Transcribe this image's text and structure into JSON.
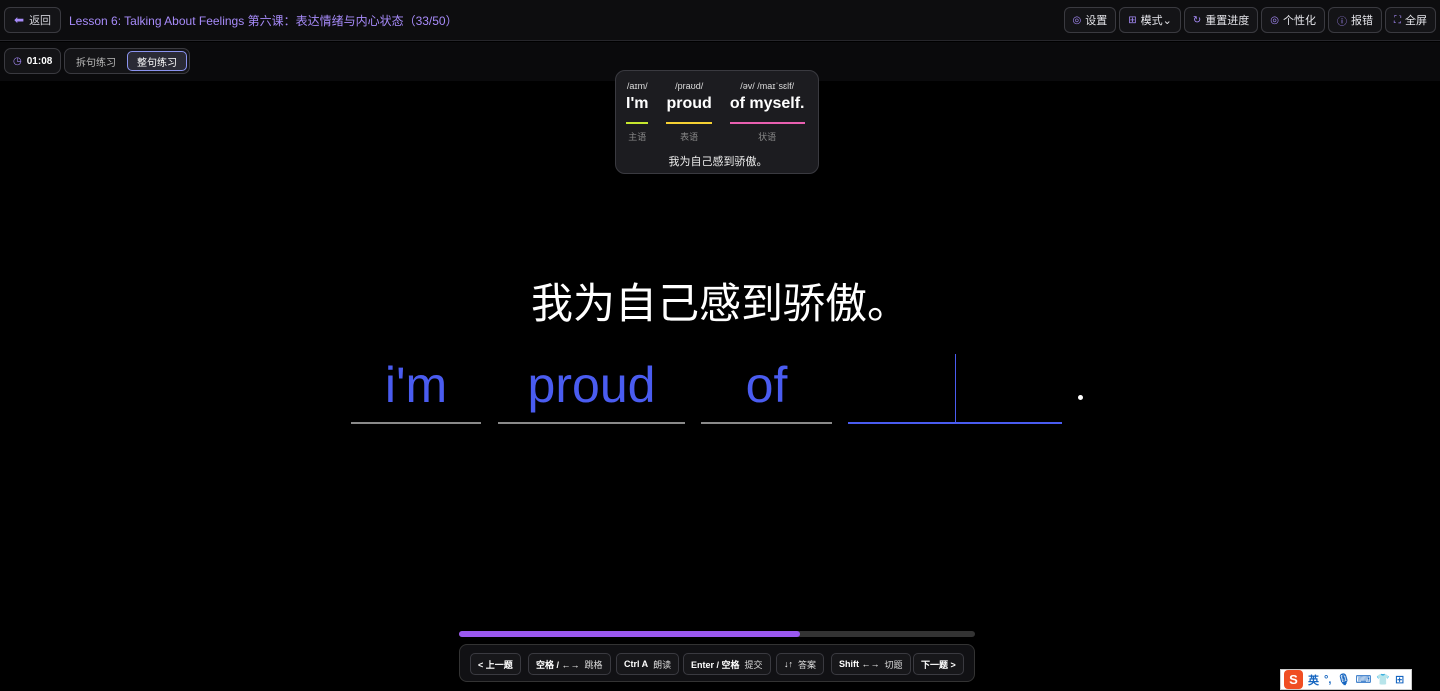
{
  "header": {
    "back_label": "返回",
    "lesson_title": "Lesson 6: Talking About Feelings 第六课：表达情绪与内心状态（33/50）",
    "toolbar": [
      {
        "icon": "gear-icon",
        "glyph": "◎",
        "label": "设置"
      },
      {
        "icon": "grid-icon",
        "glyph": "⊞",
        "label": "模式⌄"
      },
      {
        "icon": "refresh-icon",
        "glyph": "↻",
        "label": "重置进度"
      },
      {
        "icon": "palette-icon",
        "glyph": "◎",
        "label": "个性化"
      },
      {
        "icon": "alert-icon",
        "glyph": "ⓘ",
        "label": "报错"
      },
      {
        "icon": "fullscreen-icon",
        "glyph": "⛶",
        "label": "全屏"
      }
    ]
  },
  "subbar": {
    "timer": "01:08",
    "modes": [
      "拆句练习",
      "整句练习"
    ],
    "active_mode": "整句练习"
  },
  "hint": {
    "chunks": [
      {
        "phonetic": "/aɪm/",
        "word": "I'm",
        "role": "主语",
        "color": "#c6e62e"
      },
      {
        "phonetic": "/praʊd/",
        "word": "proud",
        "role": "表语",
        "color": "#f5d033"
      },
      {
        "phonetic": "/əv/ /maɪˈsɛlf/",
        "word": "of myself.",
        "role": "状语",
        "color": "#e85fb0"
      }
    ],
    "translation": "我为自己感到骄傲。"
  },
  "main": {
    "chinese": "我为自己感到骄傲。",
    "answers": [
      "i'm",
      "proud",
      "of",
      ""
    ],
    "accent": "#4a5cf0"
  },
  "progress": {
    "fraction": 0.66,
    "color": "#9b59f0"
  },
  "shortcuts": [
    {
      "key": "< 上一题",
      "label": ""
    },
    {
      "key": "空格 / ←→",
      "label": "跳格"
    },
    {
      "key": "Ctrl A",
      "label": "朗读"
    },
    {
      "key": "Enter / 空格",
      "label": "提交"
    },
    {
      "key": "↓↑",
      "label": "答案"
    },
    {
      "key": "Shift ←→",
      "label": "切题"
    },
    {
      "key": "下一题 >",
      "label": ""
    }
  ],
  "ime": {
    "lang": "英"
  }
}
